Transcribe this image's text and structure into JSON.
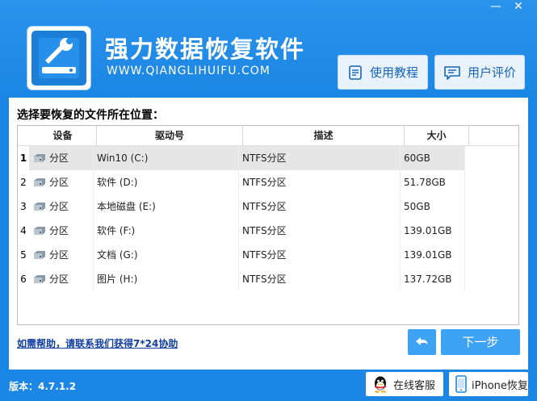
{
  "window": {
    "minimize_glyph": "—",
    "close_glyph": "✕"
  },
  "app": {
    "title": "强力数据恢复软件",
    "site": "WWW.QIANGLIHUIFU.COM",
    "logo_icon": "hard-drive-wrench-icon",
    "accent_color": "#1b86e3"
  },
  "header_buttons": {
    "tutorial_label": "使用教程",
    "review_label": "用户评价"
  },
  "panel": {
    "label": "选择要恢复的文件所在位置："
  },
  "table": {
    "columns": [
      "设备",
      "驱动号",
      "描述",
      "大小"
    ],
    "rows": [
      {
        "num": "1",
        "device": "分区",
        "drive": "Win10 (C:)",
        "desc": "NTFS分区",
        "size": "60GB",
        "selected": true
      },
      {
        "num": "2",
        "device": "分区",
        "drive": "软件 (D:)",
        "desc": "NTFS分区",
        "size": "51.78GB",
        "selected": false
      },
      {
        "num": "3",
        "device": "分区",
        "drive": "本地磁盘 (E:)",
        "desc": "NTFS分区",
        "size": "50GB",
        "selected": false
      },
      {
        "num": "4",
        "device": "分区",
        "drive": "软件 (F:)",
        "desc": "NTFS分区",
        "size": "139.01GB",
        "selected": false
      },
      {
        "num": "5",
        "device": "分区",
        "drive": "文档 (G:)",
        "desc": "NTFS分区",
        "size": "139.01GB",
        "selected": false
      },
      {
        "num": "6",
        "device": "分区",
        "drive": "图片 (H:)",
        "desc": "NTFS分区",
        "size": "137.72GB",
        "selected": false
      }
    ]
  },
  "help": {
    "text": "如需帮助，请联系我们获得7*24协助"
  },
  "nav": {
    "next_label": "下一步"
  },
  "footer": {
    "version": "版本：4.7.1.2",
    "online_service_label": "在线客服",
    "iphone_label": "iPhone恢复"
  }
}
